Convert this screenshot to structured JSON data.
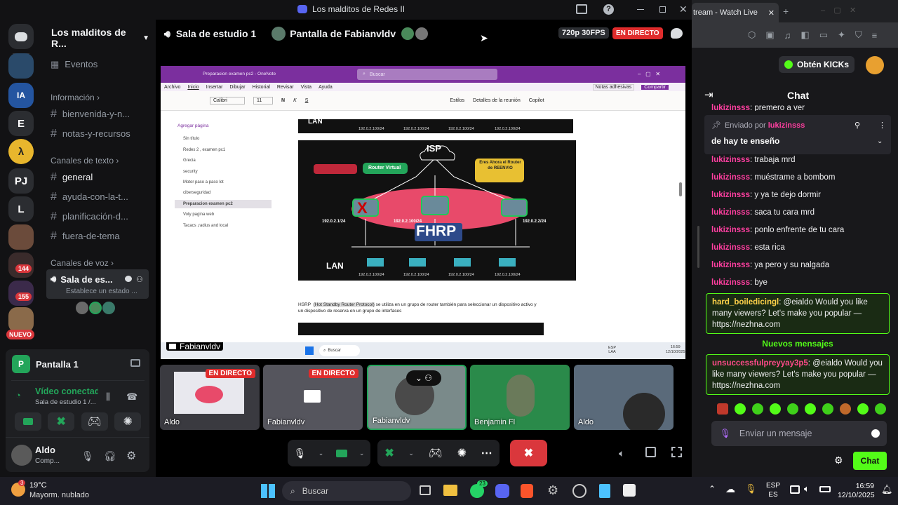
{
  "window": {
    "title": "Los malditos de Redes II"
  },
  "server": {
    "name": "Los malditos de R...",
    "events": "Eventos",
    "info_category": "Información",
    "info_channels": [
      "bienvenida-y-n...",
      "notas-y-recursos"
    ],
    "text_category": "Canales de texto",
    "text_channels": [
      "general",
      "ayuda-con-la-t...",
      "planificación-d...",
      "fuera-de-tema"
    ],
    "voice_category": "Canales de voz",
    "voice_channel": "Sala de es...",
    "voice_status": "Establece un estado ..."
  },
  "servers": {
    "badges": [
      "144",
      "155"
    ],
    "labels": [
      "E",
      "PJ",
      "L"
    ],
    "new_badge": "NUEVO"
  },
  "stage_header": {
    "channel": "Sala de estudio 1",
    "screen": "Pantalla de Fabianvldv",
    "quality": "720p 30FPS",
    "live": "EN DIRECTO"
  },
  "onenote": {
    "search": "Buscar",
    "title": "Preparacion examen pc2 - OneNote",
    "menu": [
      "Archivo",
      "Inicio",
      "Insertar",
      "Dibujar",
      "Historial",
      "Revisar",
      "Vista",
      "Ayuda"
    ],
    "sticky": "Notas adhesivas",
    "share": "Compartir",
    "font": "Calibri",
    "size": "11",
    "styles": "Estilos",
    "meeting": "Detalles de la reunión",
    "copilot": "Copilot",
    "add_page": "Agregar página",
    "pages": [
      "Sin título",
      "Redes 2 , examen pc1",
      "Grecia",
      "security",
      "Motor paso a paso lot",
      "ciberseguridad",
      "Preparacion examen pc2",
      "Voty pagina web",
      "Tacacs ,radius and local"
    ],
    "diagram": {
      "isp": "ISP",
      "router_virtual": "Router Virtual",
      "eres": "Eres Ahora el Router de REENVIO",
      "fhrp": "FHRP",
      "lan": "LAN",
      "ip1": "192.0.2.1/24",
      "ip2": "192.0.2.100/24",
      "ip3": "192.0.2.2/24",
      "hosts": "192.0.2.100/24"
    },
    "body_hsrp": "HSRP",
    "body_highlight": "(Hot Standby Router Protocol)",
    "body_rest": "se utiliza en un grupo de router también  para seleccionar un dispositivo activo y un dispositivo de reserva en un grupo de interfases",
    "taskbar_search": "Buscar",
    "tb_lang": "ESP",
    "tb_region": "LAA",
    "tb_time": "16:59",
    "tb_date": "12/10/2025",
    "presenter": "Fabianvldv"
  },
  "tiles": [
    {
      "label": "Aldo",
      "live": "EN DIRECTO"
    },
    {
      "label": "Fabianvldv",
      "live": "EN DIRECTO"
    },
    {
      "label": "Fabianvldv"
    },
    {
      "label": "Benjamin Fl"
    },
    {
      "label": "Aldo"
    }
  ],
  "bottom_panel": {
    "screen_share": "Pantalla 1",
    "video_status": "Vídeo conectad",
    "video_sub": "Sala de estudio 1 /...",
    "user": "Aldo",
    "user_status": "Comp..."
  },
  "browser": {
    "tab": "tream - Watch Live",
    "kicks": "Obtén KICKs",
    "chat_title": "Chat",
    "pinned_by": "Enviado por",
    "pinned_user": "lukizinsss",
    "pinned_text": "de hay te enseño",
    "cut_msg": "premero a ver"
  },
  "chat": {
    "messages": [
      {
        "user": "lukizinsss",
        "text": "trabaja mrd"
      },
      {
        "user": "lukizinsss",
        "text": "muéstrame a bombom"
      },
      {
        "user": "lukizinsss",
        "text": "y ya te dejo dormir"
      },
      {
        "user": "lukizinsss",
        "text": "saca tu cara mrd"
      },
      {
        "user": "lukizinsss",
        "text": "ponlo enfrente de tu cara"
      },
      {
        "user": "lukizinsss",
        "text": "esta rica"
      },
      {
        "user": "lukizinsss",
        "text": "ya pero y su nalgada"
      },
      {
        "user": "lukizinsss",
        "text": "bye"
      }
    ],
    "spam1_user": "hard_boiledicingl",
    "spam1_text": "@eialdo Would you like many viewers? Let's make you popular — https://nezhna.com",
    "new_messages": "Nuevos mensajes",
    "spam2_user": "unsuccessfulpreyyay3p5",
    "spam2_text": "@eialdo Would you like many viewers? Let's make you popular — https://nezhna.com",
    "input_placeholder": "Enviar un mensaje",
    "send": "Chat"
  },
  "taskbar": {
    "temp": "19°C",
    "weather": "Mayorm. nublado",
    "weather_badge": "3",
    "search": "Buscar",
    "whatsapp_badge": "23",
    "lang": "ESP",
    "region": "ES",
    "time": "16:59",
    "date": "12/10/2025"
  },
  "colors": {
    "kick_green": "#53fc18",
    "live_red": "#e02c2c",
    "onenote_purple": "#7b2f9e",
    "discord_bg": "#121214"
  }
}
